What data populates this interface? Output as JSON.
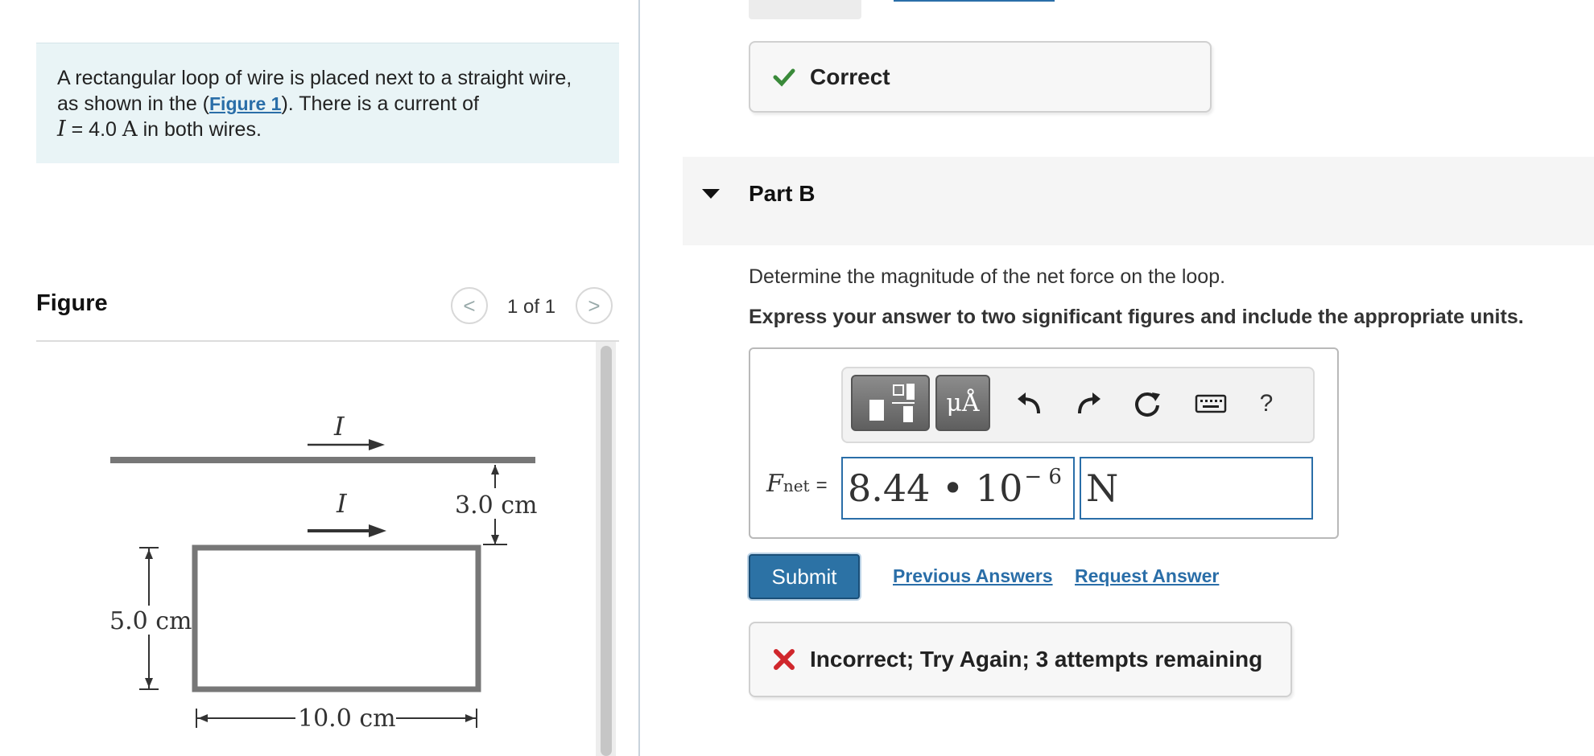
{
  "problem": {
    "text_part1": "A rectangular loop of wire is placed next to a straight wire, as shown in the (",
    "figure_link": "Figure 1",
    "text_part2": "). There is a current of",
    "current_symbol": "I",
    "current_eq": " = 4.0 ",
    "current_unit": "A",
    "text_part3": " in both wires."
  },
  "figure": {
    "title": "Figure",
    "pager": "1 of 1",
    "prev_icon": "<",
    "next_icon": ">",
    "labels": {
      "current_top": "I",
      "current_loop": "I",
      "gap": "3.0 cm",
      "height": "5.0 cm",
      "width": "10.0 cm"
    }
  },
  "previous_part": {
    "result": "Correct"
  },
  "part_b": {
    "title": "Part B",
    "question": "Determine the magnitude of the net force on the loop.",
    "instruction": "Express your answer to two significant figures and include the appropriate units.",
    "toolbar": {
      "units_label": "μÅ",
      "help_label": "?"
    },
    "answer": {
      "label_symbol": "F",
      "label_sub": "net",
      "label_eq": "=",
      "value_mantissa": "8.44 • 10",
      "value_exponent": "− 6",
      "unit": "N"
    },
    "submit_label": "Submit",
    "previous_answers_label": "Previous Answers",
    "request_answer_label": "Request Answer",
    "result": "Incorrect; Try Again; 3 attempts remaining"
  },
  "colors": {
    "link": "#2a6ea8",
    "success": "#3a8a3a",
    "error": "#d0272c",
    "submit": "#2c72a5",
    "problem_bg": "#e9f4f6"
  }
}
